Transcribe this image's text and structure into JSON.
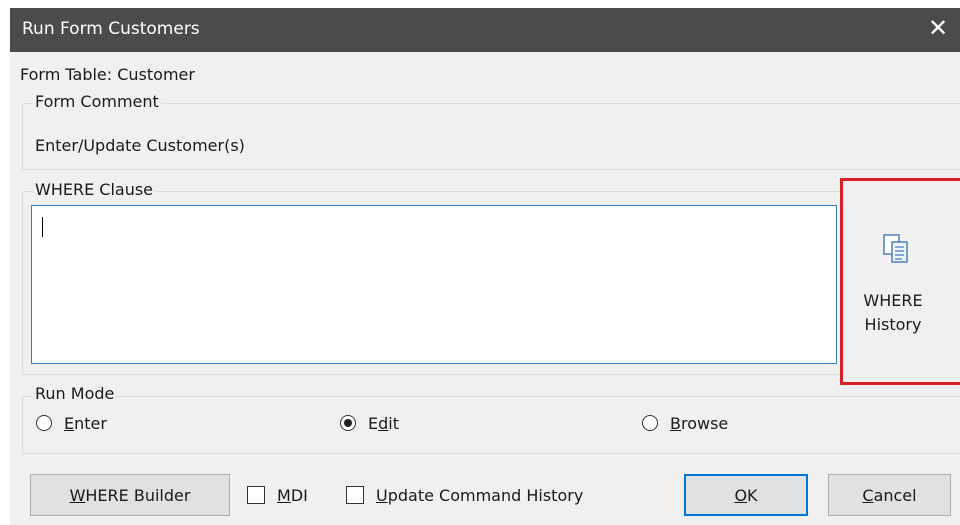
{
  "window": {
    "title": "Run Form Customers",
    "close_glyph": "✕"
  },
  "form_table": "Form Table: Customer",
  "form_comment": {
    "label": "Form Comment",
    "value": "Enter/Update Customer(s)"
  },
  "where_clause": {
    "label": "WHERE Clause",
    "value": ""
  },
  "where_history": {
    "line1": "WHERE",
    "line2": "History",
    "icon": "document-stack-icon"
  },
  "run_mode": {
    "label": "Run Mode",
    "options": [
      {
        "prefix": "",
        "mnemonic": "E",
        "rest": "nter",
        "checked": false
      },
      {
        "prefix": "E",
        "mnemonic": "d",
        "rest": "it",
        "checked": true
      },
      {
        "prefix": "",
        "mnemonic": "B",
        "rest": "rowse",
        "checked": false
      }
    ]
  },
  "buttons": {
    "where_builder": {
      "mnemonic": "W",
      "rest": "HERE Builder"
    },
    "ok": {
      "mnemonic": "O",
      "rest": "K"
    },
    "cancel": {
      "mnemonic": "C",
      "rest": "ancel"
    }
  },
  "checkboxes": {
    "mdi": {
      "mnemonic": "M",
      "rest": "DI",
      "checked": false
    },
    "update_history": {
      "mnemonic": "U",
      "rest": "pdate Command History",
      "checked": false
    }
  },
  "colors": {
    "titlebar": "#4b4b4b",
    "highlight": "#d6202a",
    "focus": "#0078d7"
  }
}
